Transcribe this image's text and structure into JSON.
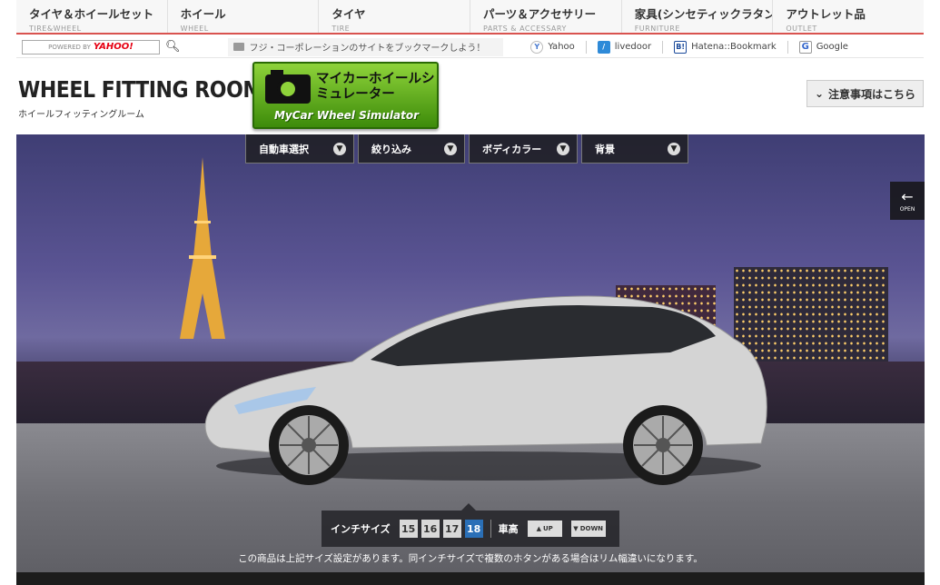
{
  "topnav": [
    {
      "jp": "タイヤ＆ホイールセット",
      "en": "TIRE&WHEEL"
    },
    {
      "jp": "ホイール",
      "en": "WHEEL"
    },
    {
      "jp": "タイヤ",
      "en": "TIRE"
    },
    {
      "jp": "パーツ＆アクセサリー",
      "en": "PARTS & ACCESSARY"
    },
    {
      "jp": "家具(シンセティックラタン)",
      "en": "FURNITURE"
    },
    {
      "jp": "アウトレット品",
      "en": "OUTLET"
    }
  ],
  "search": {
    "powered": "POWERED BY",
    "brand": "YAHOO!"
  },
  "bookmark_msg": "フジ・コーポレーションのサイトをブックマークしよう！",
  "bookmarks": [
    {
      "label": "Yahoo",
      "icon": "Y"
    },
    {
      "label": "livedoor",
      "icon": "/"
    },
    {
      "label": "Hatena::Bookmark",
      "icon": "B!"
    },
    {
      "label": "Google",
      "icon": "G"
    }
  ],
  "header": {
    "title": "WHEEL FITTING ROOM",
    "subtitle": "ホイールフィッティングルーム",
    "sim_jp": "マイカーホイールシミュレーター",
    "sim_en": "MyCar Wheel Simulator",
    "notice": "注意事項はこちら"
  },
  "filters": [
    "自動車選択",
    "絞り込み",
    "ボディカラー",
    "背景"
  ],
  "open_label": "OPEN",
  "controls": {
    "inch_label": "インチサイズ",
    "sizes": [
      "15",
      "16",
      "17",
      "18"
    ],
    "active_size": "18",
    "height_label": "車高",
    "up": "UP",
    "down": "DOWN"
  },
  "note": "この商品は上記サイズ設定があります。同インチサイズで複数のホタンがある場合はリム幅違いになります。"
}
